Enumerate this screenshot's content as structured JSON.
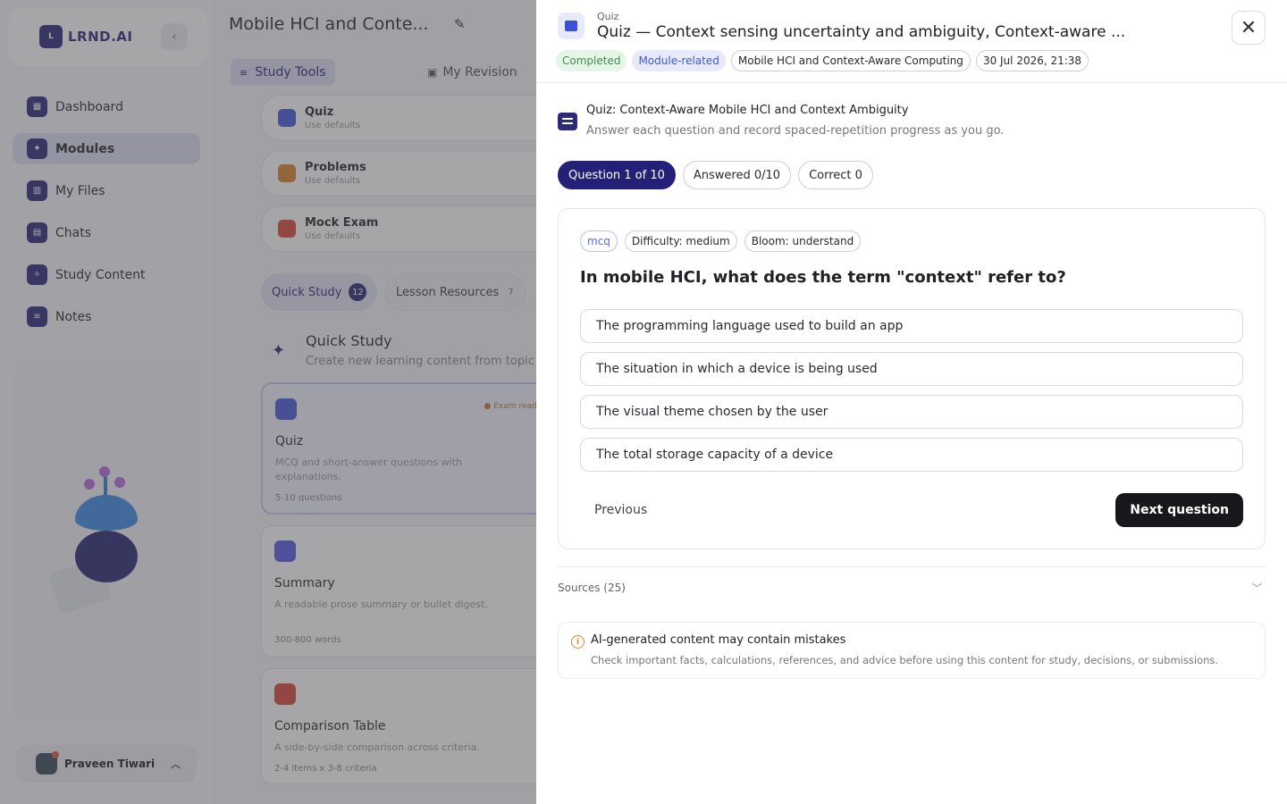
{
  "sidebar": {
    "logo_text": "LRND.AI",
    "logo_mark": "L",
    "collapse_icon": "chevron-left-icon",
    "items": [
      {
        "label": "Dashboard",
        "icon": "dashboard-icon",
        "active": false
      },
      {
        "label": "Modules",
        "icon": "modules-icon",
        "active": true
      },
      {
        "label": "My Files",
        "icon": "files-icon",
        "active": false
      },
      {
        "label": "Chats",
        "icon": "chats-icon",
        "active": false
      },
      {
        "label": "Study Content",
        "icon": "study-content-icon",
        "active": false
      },
      {
        "label": "Notes",
        "icon": "notes-icon",
        "active": false
      }
    ],
    "user": {
      "name": "Praveen Tiwari"
    }
  },
  "main": {
    "module_title": "Mobile HCI and Conte...",
    "tabs": {
      "study_tools": "Study Tools",
      "my_revision": "My Revision"
    },
    "tool_cards": [
      {
        "name": "Quiz",
        "sub": "Use defaults",
        "color": "#4a5bd6"
      },
      {
        "name": "Problems",
        "sub": "Use defaults",
        "color": "#d9822b"
      },
      {
        "name": "Mock Exam",
        "sub": "Use defaults",
        "color": "#d94a3b"
      }
    ],
    "pills": {
      "quick_study": "Quick Study",
      "quick_study_count": "12",
      "lesson_resources": "Lesson Resources",
      "lesson_resources_count": "7"
    },
    "quick_study": {
      "title": "Quick Study",
      "subtitle": "Create new learning content from topic"
    },
    "content_cards": [
      {
        "title": "Quiz",
        "desc": "MCQ and short-answer questions with explanations.",
        "meta": "5-10 questions",
        "badge": "Exam ready",
        "color": "#4a5bd6"
      },
      {
        "title": "Summary",
        "desc": "A readable prose summary or bullet digest.",
        "meta": "300-800 words",
        "color": "#5a5ae0"
      },
      {
        "title": "Comparison Table",
        "desc": "A side-by-side comparison across criteria.",
        "meta": "2-4 items x 3-8 criteria",
        "color": "#d94a3b"
      }
    ]
  },
  "drawer": {
    "kicker": "Quiz",
    "title": "Quiz — Context sensing uncertainty and ambiguity, Context-aware ...",
    "badges": {
      "status": "Completed",
      "relation": "Module-related",
      "module": "Mobile HCI and Context-Aware Computing",
      "timestamp": "30 Jul 2026, 21:38"
    },
    "quiz_title": "Quiz: Context-Aware Mobile HCI and Context Ambiguity",
    "quiz_subtitle": "Answer each question and record spaced-repetition progress as you go.",
    "progress": {
      "question": "Question 1 of 10",
      "answered": "Answered 0/10",
      "correct": "Correct 0"
    },
    "tags": {
      "type": "mcq",
      "difficulty": "Difficulty: medium",
      "bloom": "Bloom: understand"
    },
    "question": "In mobile HCI, what does the term \"context\" refer to?",
    "options": [
      "The programming language used to build an app",
      "The situation in which a device is being used",
      "The visual theme chosen by the user",
      "The total storage capacity of a device"
    ],
    "previous_label": "Previous",
    "next_label": "Next question",
    "sources_label": "Sources (25)",
    "ai_note": {
      "title": "AI-generated content may contain mistakes",
      "text": "Check important facts, calculations, references, and advice before using this content for study, decisions, or submissions."
    },
    "close_icon": "close-icon"
  },
  "colors": {
    "primary": "#242078",
    "accent_blue": "#4357d6",
    "success": "#3d8f4e",
    "warning": "#d9822b"
  }
}
